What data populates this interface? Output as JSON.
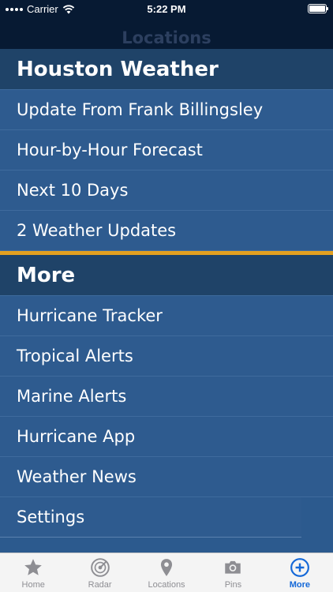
{
  "status_bar": {
    "carrier": "Carrier",
    "time": "5:22 PM"
  },
  "nav": {
    "title": "Locations"
  },
  "sections": [
    {
      "title": "Houston Weather",
      "items": [
        "Update From Frank Billingsley",
        "Hour-by-Hour Forecast",
        "Next 10 Days",
        "2 Weather Updates"
      ]
    },
    {
      "title": "More",
      "items": [
        "Hurricane Tracker",
        "Tropical Alerts",
        "Marine Alerts",
        "Hurricane App",
        "Weather News",
        "Settings"
      ]
    }
  ],
  "colors": {
    "accent_separator": "#e3a020",
    "active_tab": "#1468d8",
    "row_background": "#2e5b8f"
  },
  "tabs": [
    {
      "label": "Home",
      "icon": "star-icon"
    },
    {
      "label": "Radar",
      "icon": "radar-icon"
    },
    {
      "label": "Locations",
      "icon": "location-pin-icon"
    },
    {
      "label": "Pins",
      "icon": "camera-icon"
    },
    {
      "label": "More",
      "icon": "plus-circle-icon",
      "active": true
    }
  ]
}
